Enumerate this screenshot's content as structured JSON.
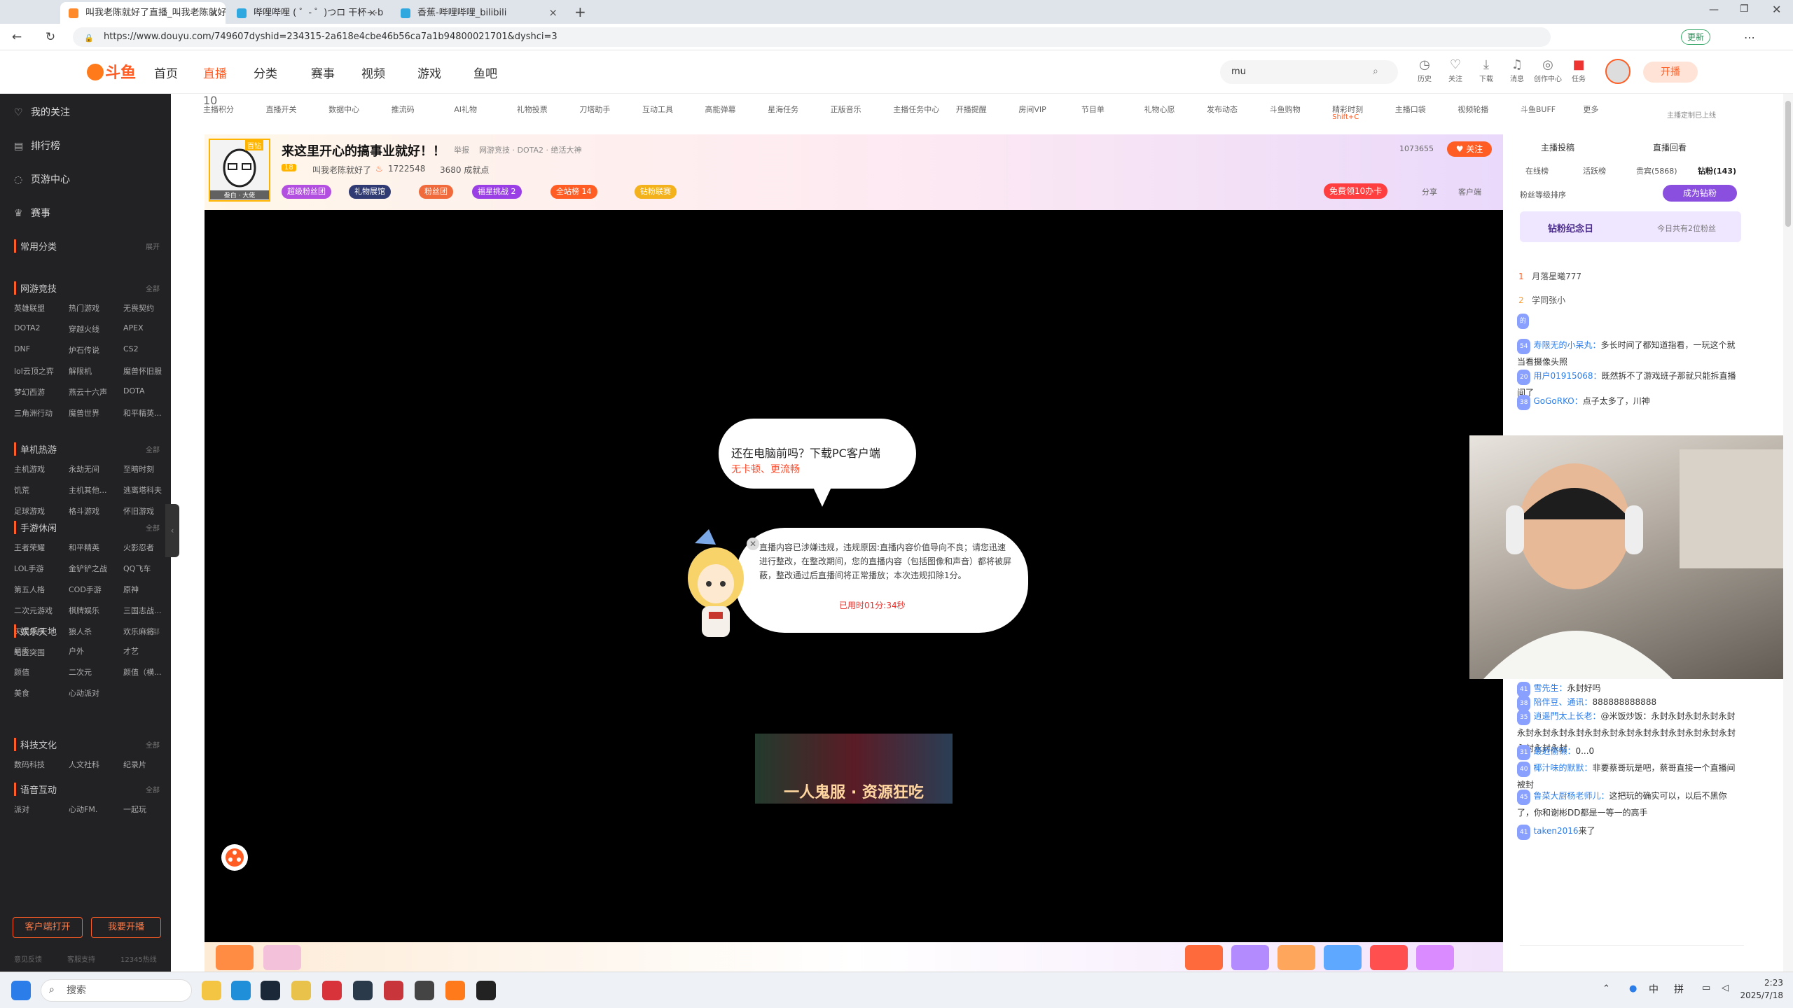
{
  "browser": {
    "tabs": [
      {
        "title": "叫我老陈就好了直播_叫我老陈就好了...",
        "active": true
      },
      {
        "title": "哔哩哔哩 ( ゜- ゜)つロ 干杯~-bilibili",
        "active": false
      },
      {
        "title": "香蕉-哔哩哔哩_bilibili",
        "active": false
      }
    ],
    "url": "https://www.douyu.com/749607dyshid=234315-2a618e4cbe46b56ca7a1b94800021701&dyshci=3",
    "update_label": "更新"
  },
  "header": {
    "logo_text": "斗鱼",
    "nav": [
      "首页",
      "直播",
      "分类",
      "赛事",
      "视频",
      "游戏",
      "鱼吧"
    ],
    "search_value": "mu",
    "icons": [
      "历史",
      "关注",
      "下载",
      "消息",
      "创作中心",
      "任务"
    ],
    "start_label": "开播"
  },
  "sidebar": {
    "top_items": [
      "我的关注",
      "排行榜",
      "页游中心",
      "赛事"
    ],
    "common_label": "常用分类",
    "expand_label": "展开",
    "all_label": "全部",
    "sections": [
      {
        "title": "网游竞技",
        "items": [
          "英雄联盟",
          "热门游戏",
          "无畏契约",
          "DOTA2",
          "穿越火线",
          "APEX",
          "DNF",
          "炉石传说",
          "CS2",
          "lol云顶之弈",
          "解限机",
          "魔兽怀旧服",
          "梦幻西游",
          "燕云十六声",
          "DOTA",
          "三角洲行动",
          "魔兽世界",
          "和平精英..."
        ]
      },
      {
        "title": "单机热游",
        "items": [
          "主机游戏",
          "永劫无间",
          "至暗时刻",
          "饥荒",
          "主机其他...",
          "逃离塔科夫",
          "足球游戏",
          "格斗游戏",
          "怀旧游戏"
        ]
      },
      {
        "title": "手游休闲",
        "items": [
          "王者荣耀",
          "和平精英",
          "火影忍者",
          "LOL手游",
          "金铲铲之战",
          "QQ飞车",
          "第五人格",
          "COD手游",
          "原神",
          "二次元游戏",
          "棋牌娱乐",
          "三国志战...",
          "天天象棋",
          "狼人杀",
          "欢乐麻将",
          "暗区突围"
        ]
      },
      {
        "title": "娱乐天地",
        "items": [
          "星秀",
          "户外",
          "才艺",
          "颜值",
          "二次元",
          "颜值（横...",
          "美食",
          "心动派对"
        ]
      },
      {
        "title": "科技文化",
        "items": [
          "数码科技",
          "人文社科",
          "纪录片"
        ]
      },
      {
        "title": "语音互动",
        "items": [
          "派对",
          "心动FM.",
          "一起玩"
        ]
      }
    ],
    "buttons": [
      "客户端打开",
      "我要开播"
    ],
    "footer": [
      "意见反馈",
      "客服支持",
      "12345热线"
    ]
  },
  "toolbar": {
    "items": [
      "主播积分",
      "直播开关",
      "数据中心",
      "推流码",
      "AI礼物",
      "礼物投票",
      "刀塔助手",
      "互动工具",
      "高能弹幕",
      "星海任务",
      "正版音乐",
      "主播任务中心",
      "开播提醒",
      "房间VIP",
      "节目单",
      "礼物心愿",
      "发布动态",
      "斗鱼购物",
      "精彩时刻",
      "主播口袋",
      "视频轮播",
      "斗鱼BUFF",
      "更多"
    ],
    "score": "10",
    "shortcut": "Shift+C",
    "side_note": "主播定制已上线"
  },
  "streamer": {
    "avatar_badge": "百钻",
    "avatar_caption": "叁白 · 大佬",
    "title": "来这里开心的搞事业就好！！",
    "report": "举报",
    "category": "网游竞技 · DOTA2 · 绝活大神",
    "level": "18",
    "name": "叫我老陈就好了",
    "hot": "1722548",
    "achieve": "3680 成就点",
    "fans": "1073655",
    "follow_label": "关注",
    "tags": [
      "超级粉丝团",
      "礼物展馆",
      "粉丝团",
      "福星挑战 2",
      "全站榜 14",
      "钻粉联赛"
    ],
    "free_card": "免费领10办卡",
    "share": "分享",
    "client": "客户端"
  },
  "player": {
    "bubble_title": "还在电脑前吗？下载PC客户端",
    "bubble_sub": "无卡顿、更流畅",
    "notice": "直播内容已涉嫌违规，违规原因:直播内容价值导向不良；请您迅速进行整改，在整改期间，您的直播内容（包括图像和声音）都将被屏蔽，整改通过后直播间将正常播放；本次违规扣除1分。",
    "used_time": "已用时01分:34秒",
    "ad_text": "一人鬼服 · 资源狂吃"
  },
  "chat": {
    "top_links": [
      "主播投稿",
      "直播回看"
    ],
    "tabs": [
      "在线榜",
      "活跃榜",
      "贵宾(5868)",
      "钻粉(143)"
    ],
    "sort_label": "粉丝等级排序",
    "become_label": "成为钻粉",
    "anniv_title": "钻粉纪念日",
    "anniv_sub": "今日共有2位粉丝",
    "ranks": [
      {
        "n": "1",
        "name": "月落星曦777"
      },
      {
        "n": "2",
        "name": "学同张小"
      }
    ],
    "messages": [
      {
        "lvl": "的",
        "name": "",
        "text": ""
      },
      {
        "lvl": "54",
        "name": "寿限无的小呆丸：",
        "text": "多长时间了都知道指看，一玩这个就当看摄像头照"
      },
      {
        "lvl": "20",
        "name": "用户01915068：",
        "text": "既然拆不了游戏班子那就只能拆直播间了"
      },
      {
        "lvl": "38",
        "name": "GoGoRKO：",
        "text": "点子太多了，川神"
      },
      {
        "lvl": "41",
        "name": "雪先生：",
        "text": "永封好吗"
      },
      {
        "lvl": "38",
        "name": "陪伴豆、通讯：",
        "text": "888888888888"
      },
      {
        "lvl": "35",
        "name": "逍遥門太上长老：",
        "text": "@米饭炒饭：永封永封永封永封永封永封永封永封永封永封永封永封永封永封永封永封永封永封永封永封永封"
      },
      {
        "lvl": "31",
        "name": "最近偷懒：",
        "text": "0...0"
      },
      {
        "lvl": "40",
        "name": "椰汁味的默默：",
        "text": "非要蔡哥玩是吧，蔡哥直接一个直播间被封"
      },
      {
        "lvl": "45",
        "name": "鲁菜大厨杨老师儿：",
        "text": "这把玩的确实可以，以后不黑你了，你和谢彬DD都是一等一的高手"
      },
      {
        "lvl": "41",
        "name": "taken2016",
        "text": "来了"
      }
    ]
  },
  "taskbar": {
    "search_label": "搜索",
    "time": "2:23",
    "date": "2025/7/18",
    "ime": [
      "中",
      "拼"
    ]
  },
  "colors": {
    "accent": "#ff5d23",
    "sidebar": "#222225",
    "player": "#000000"
  }
}
